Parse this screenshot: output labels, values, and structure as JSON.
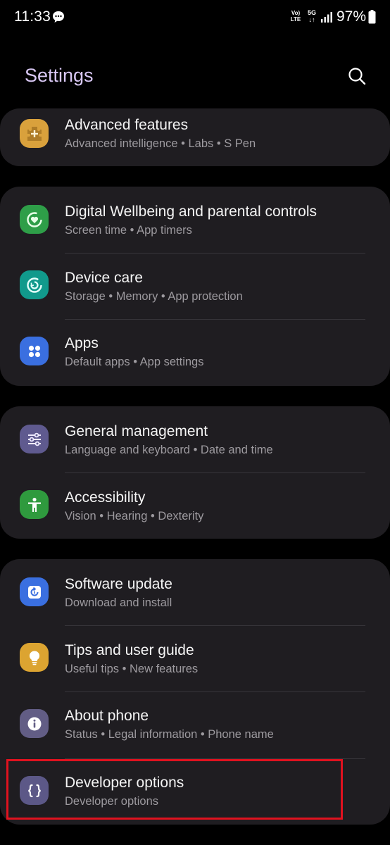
{
  "status_bar": {
    "time": "11:33",
    "volte_line1": "Vo)",
    "volte_line2": "LTE",
    "network": "5G",
    "network_arrows": "↓↑",
    "battery": "97%"
  },
  "header": {
    "title": "Settings"
  },
  "groups": [
    {
      "items": [
        {
          "title": "Advanced features",
          "subtitle": "Advanced intelligence  •  Labs  •  S Pen",
          "icon": "puzzle-plus-icon",
          "icon_color": "#d9a13c"
        }
      ]
    },
    {
      "items": [
        {
          "title": "Digital Wellbeing and parental controls",
          "subtitle": "Screen time  •  App timers",
          "icon": "heart-circle-icon",
          "icon_color": "#2e9e48"
        },
        {
          "title": "Device care",
          "subtitle": "Storage  •  Memory  •  App protection",
          "icon": "refresh-circle-icon",
          "icon_color": "#119a8c"
        },
        {
          "title": "Apps",
          "subtitle": "Default apps  •  App settings",
          "icon": "grid-dots-icon",
          "icon_color": "#3a6fe0"
        }
      ]
    },
    {
      "items": [
        {
          "title": "General management",
          "subtitle": "Language and keyboard  •  Date and time",
          "icon": "sliders-icon",
          "icon_color": "#5f5a8f"
        },
        {
          "title": "Accessibility",
          "subtitle": "Vision  •  Hearing  •  Dexterity",
          "icon": "person-icon",
          "icon_color": "#2f9a3e"
        }
      ]
    },
    {
      "items": [
        {
          "title": "Software update",
          "subtitle": "Download and install",
          "icon": "update-icon",
          "icon_color": "#3a6fe0"
        },
        {
          "title": "Tips and user guide",
          "subtitle": "Useful tips  •  New features",
          "icon": "lightbulb-icon",
          "icon_color": "#dca431"
        },
        {
          "title": "About phone",
          "subtitle": "Status  •  Legal information  •  Phone name",
          "icon": "info-icon",
          "icon_color": "#625d85"
        },
        {
          "title": "Developer options",
          "subtitle": "Developer options",
          "icon": "braces-icon",
          "icon_color": "#5c5887"
        }
      ]
    }
  ],
  "colors": {
    "background": "#000000",
    "card": "#1f1d21",
    "title_accent": "#d9c8f5",
    "highlight": "#e0121f"
  }
}
